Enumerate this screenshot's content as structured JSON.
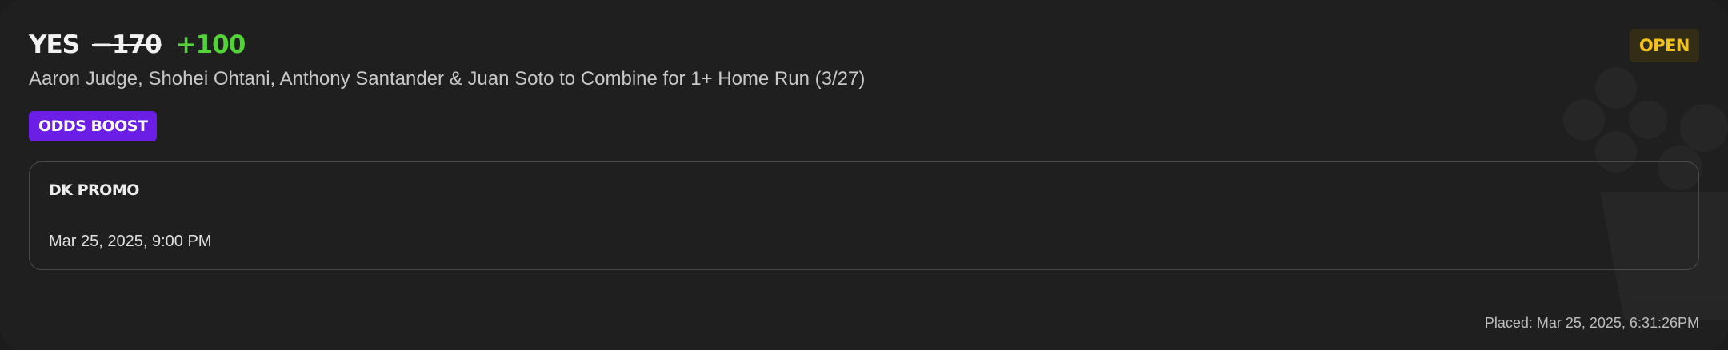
{
  "bet": {
    "pick": "YES",
    "original_odds": "−170",
    "boosted_odds": "+100",
    "description": "Aaron Judge, Shohei Ohtani, Anthony Santander & Juan Soto to Combine for 1+ Home Run (3/27)",
    "boost_label": "ODDS BOOST",
    "status": "OPEN"
  },
  "promo": {
    "title": "DK PROMO",
    "date": "Mar 25, 2025, 9:00 PM"
  },
  "footer": {
    "placed": "Placed: Mar 25, 2025, 6:31:26PM"
  },
  "colors": {
    "background": "#1f1f1f",
    "odds_positive": "#53d337",
    "boost_badge": "#6b1fe6",
    "status_text": "#f1c21b",
    "status_bg": "#332d16"
  },
  "icons": {
    "watermark": "crown-watermark-icon"
  }
}
